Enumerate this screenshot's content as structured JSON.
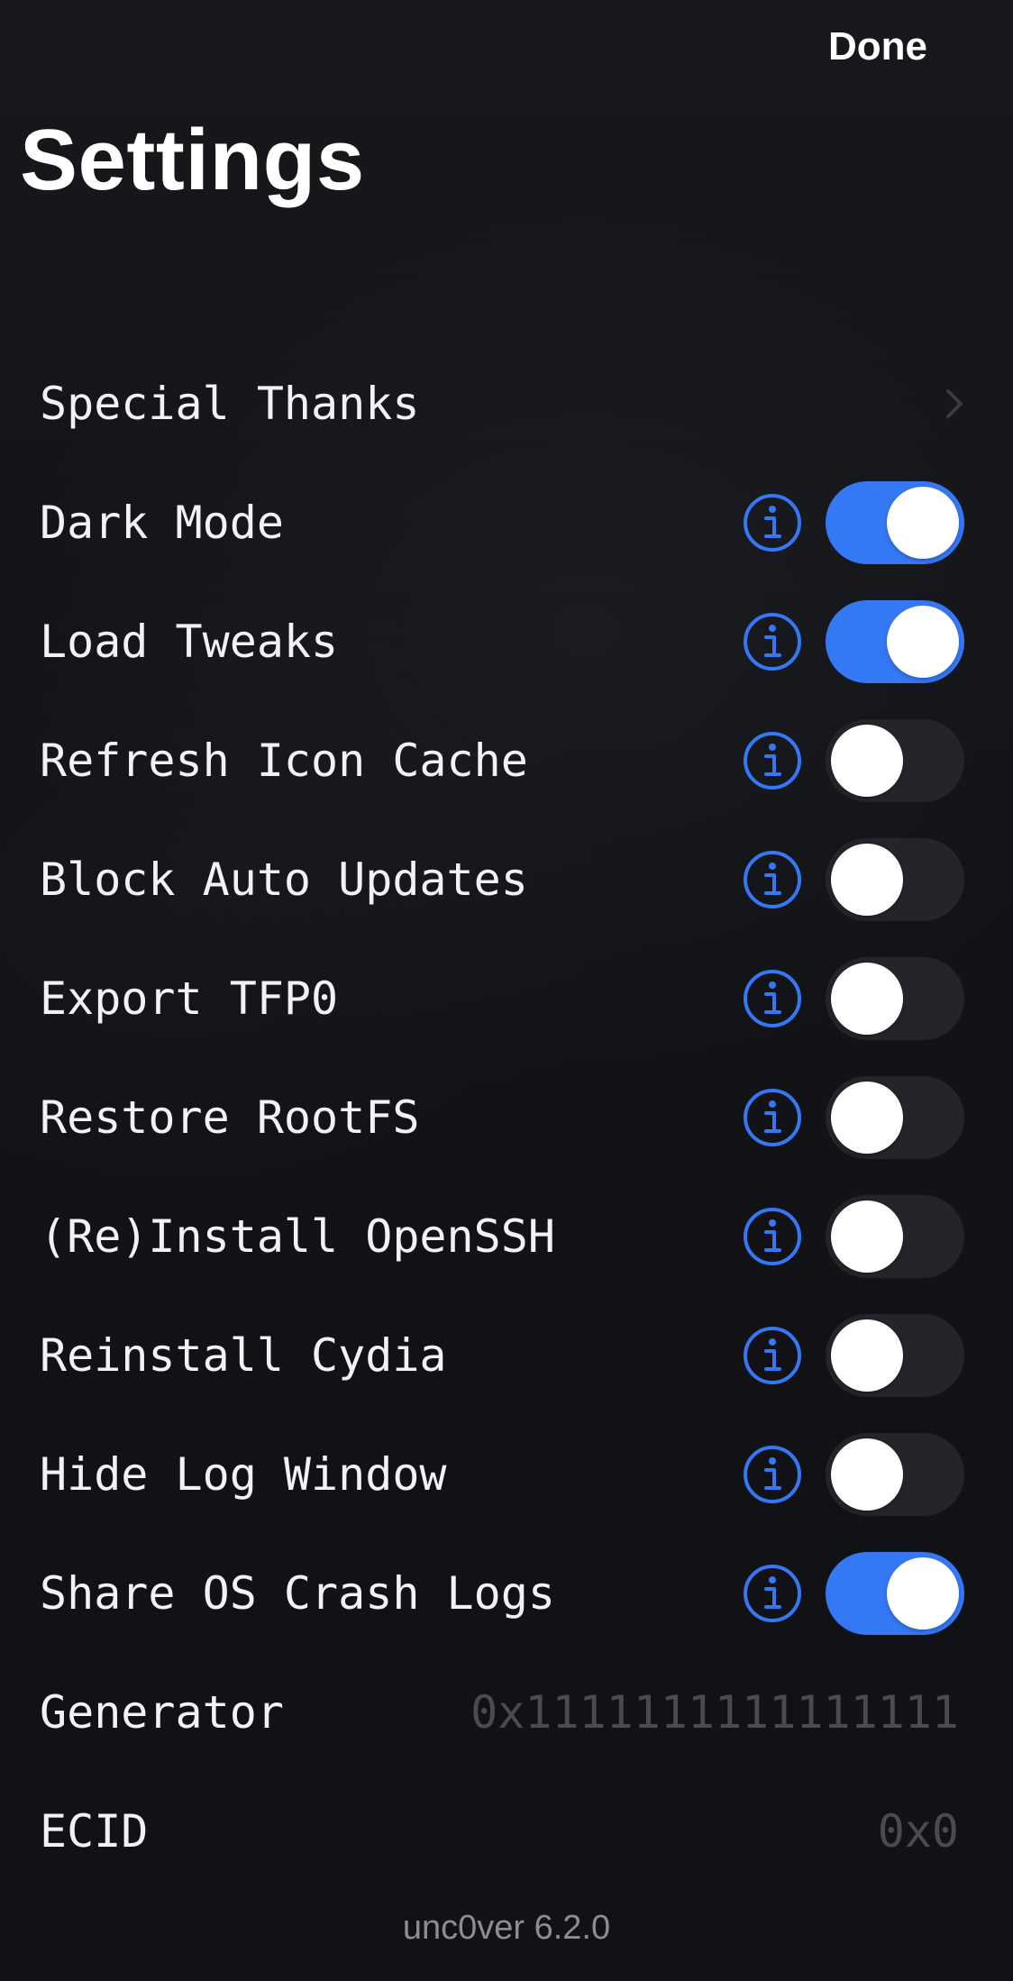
{
  "header": {
    "done_label": "Done",
    "title": "Settings"
  },
  "rows": {
    "special_thanks": {
      "label": "Special Thanks"
    },
    "dark_mode": {
      "label": "Dark Mode",
      "on": true
    },
    "load_tweaks": {
      "label": "Load Tweaks",
      "on": true
    },
    "refresh_icon_cache": {
      "label": "Refresh Icon Cache",
      "on": false
    },
    "block_auto_updates": {
      "label": "Block Auto Updates",
      "on": false
    },
    "export_tfp0": {
      "label": "Export TFP0",
      "on": false
    },
    "restore_rootfs": {
      "label": "Restore RootFS",
      "on": false
    },
    "reinstall_openssh": {
      "label": "(Re)Install OpenSSH",
      "on": false
    },
    "reinstall_cydia": {
      "label": "Reinstall Cydia",
      "on": false
    },
    "hide_log_window": {
      "label": "Hide Log Window",
      "on": false
    },
    "share_os_crash_logs": {
      "label": "Share OS Crash Logs",
      "on": true
    },
    "generator": {
      "label": "Generator",
      "value": "0x1111111111111111"
    },
    "ecid": {
      "label": "ECID",
      "value": "0x0"
    }
  },
  "footer": {
    "version": "unc0ver 6.2.0"
  },
  "colors": {
    "accent": "#3478f6",
    "background": "#131418",
    "toggle_off": "#24252a",
    "value_text": "#4a4b50",
    "version_text": "#8c8d92"
  },
  "icons": {
    "info": "info-circle-icon",
    "chevron": "chevron-right-icon"
  }
}
